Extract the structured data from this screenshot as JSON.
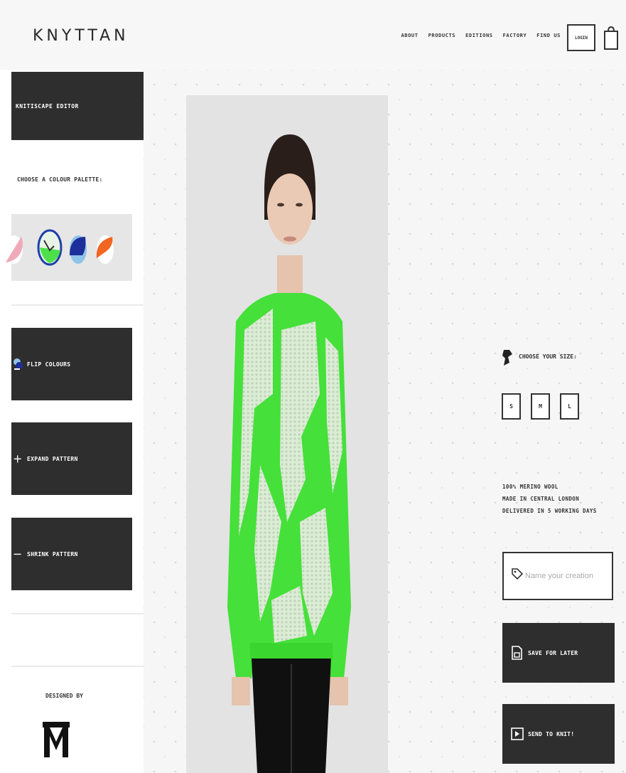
{
  "header": {
    "logo": "KNYTTAN",
    "nav": [
      "ABOUT",
      "PRODUCTS",
      "EDITIONS",
      "FACTORY",
      "FIND US"
    ],
    "login_label": "LOGIN"
  },
  "sidebar": {
    "editor_title": "KNITISCAPE EDITOR",
    "palette_label": "CHOOSE A COLOUR PALETTE:",
    "palettes": [
      {
        "name": "pink-white",
        "colors": [
          "#f0a9b8",
          "#ffffff"
        ]
      },
      {
        "name": "green-white",
        "colors": [
          "#4de04a",
          "#e8f4e6"
        ],
        "selected": true
      },
      {
        "name": "navy-lightblue",
        "colors": [
          "#1d2f9a",
          "#8fc3e8"
        ]
      },
      {
        "name": "orange-white",
        "colors": [
          "#f26522",
          "#ffffff"
        ]
      }
    ],
    "flip_label": "FLIP COLOURS",
    "expand_label": "EXPAND PATTERN",
    "shrink_label": "SHRINK PATTERN",
    "designed_by_label": "DESIGNED BY"
  },
  "product": {
    "size_label": "CHOOSE YOUR SIZE:",
    "sizes": [
      "S",
      "M",
      "L"
    ],
    "info": [
      "100% MERINO WOOL",
      "MADE IN CENTRAL LONDON",
      "DELIVERED IN 5 WORKING DAYS"
    ],
    "name_placeholder": "Name your creation",
    "save_label": "SAVE FOR LATER",
    "send_label": "SEND TO KNIT!"
  },
  "colors": {
    "dark_button": "#2e2e2e",
    "sweater_green": "#45e03a",
    "sweater_light": "#d9ecd4"
  },
  "icons": {
    "cart": "shopping-bag-icon",
    "flip": "flip-colours-icon",
    "expand": "plus-icon",
    "shrink": "minus-icon",
    "size": "size-icon",
    "tag": "tag-icon",
    "save": "save-icon",
    "send": "send-icon"
  }
}
